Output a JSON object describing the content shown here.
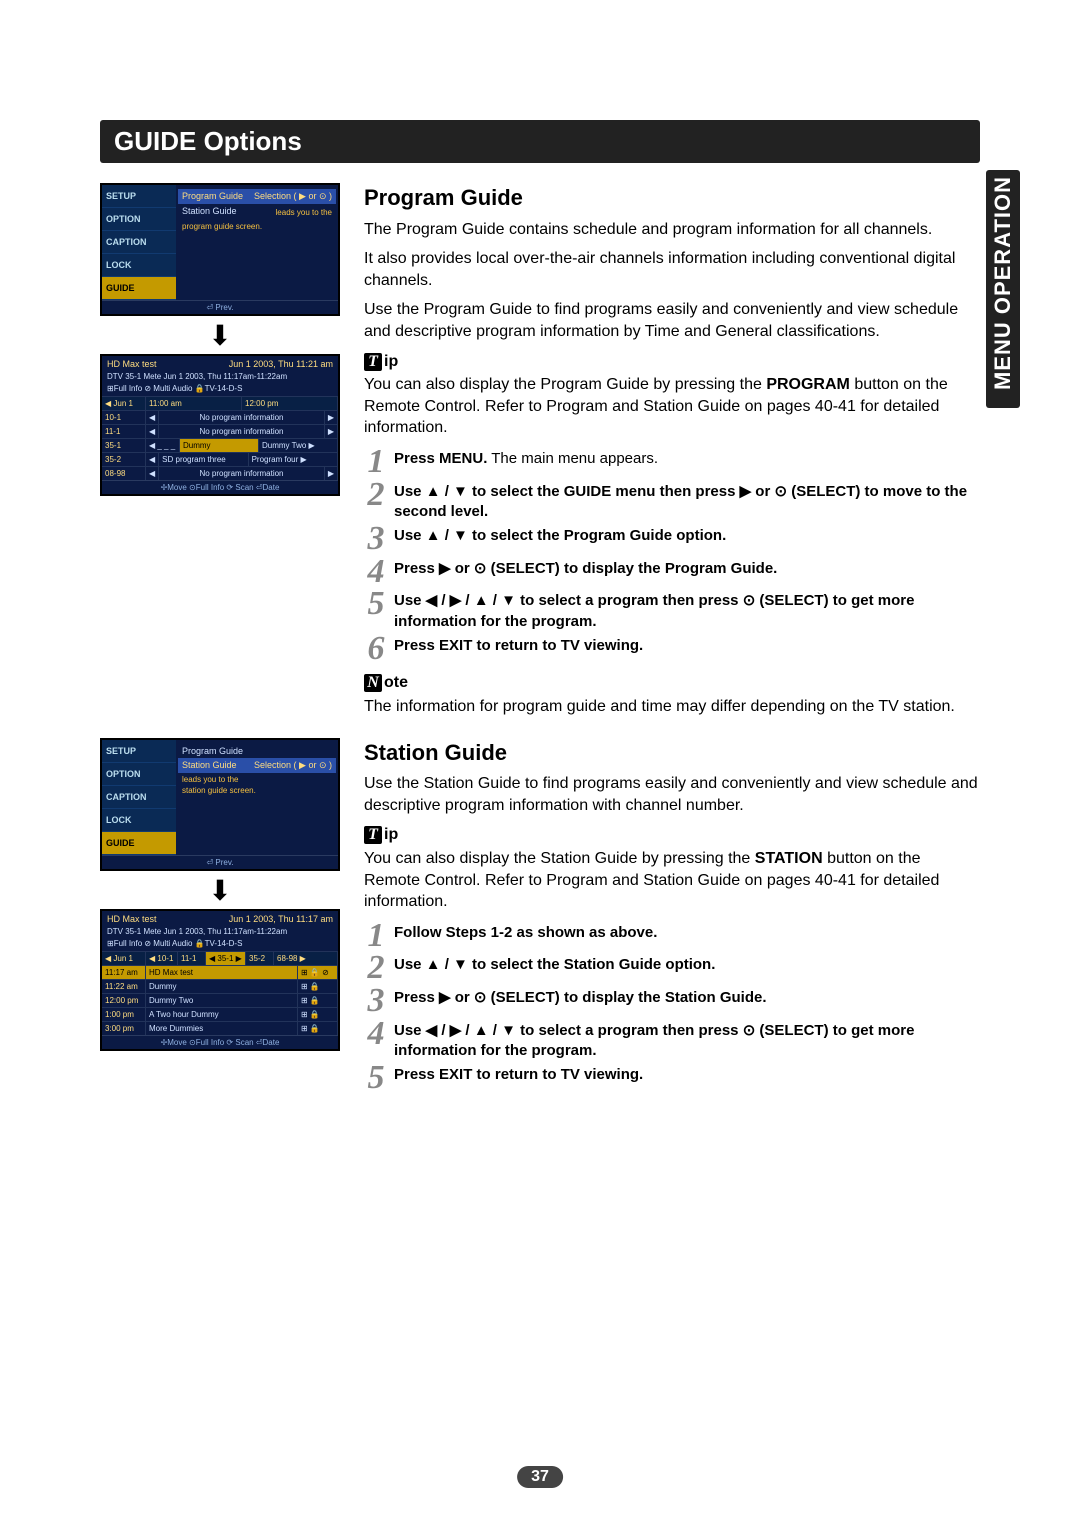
{
  "title_bar": "GUIDE Options",
  "side_tab": "MENU OPERATION",
  "page_number": "37",
  "program_guide": {
    "heading": "Program Guide",
    "intro1": "The Program Guide contains schedule and program information for all channels.",
    "intro2": "It also provides local over-the-air channels information including conventional digital channels.",
    "intro3": "Use the Program Guide to find programs easily and conveniently and view schedule and descriptive program information by Time and General classifications.",
    "tip_letter": "T",
    "tip_suffix": "ip",
    "tip_text_before": "You can also display the Program Guide by pressing the ",
    "tip_bold": "PROGRAM",
    "tip_text_after": " button on the Remote Control. Refer to Program and Station Guide on pages 40-41 for detailed information.",
    "steps": [
      {
        "n": "1",
        "bold": "Press MENU.",
        "rest": " The main menu appears."
      },
      {
        "n": "2",
        "bold": "Use ▲ / ▼ to select the GUIDE menu then press ▶ or ⊙ (SELECT) to move to the second level.",
        "rest": ""
      },
      {
        "n": "3",
        "bold": "Use ▲ / ▼ to select the Program Guide option.",
        "rest": ""
      },
      {
        "n": "4",
        "bold": "Press ▶ or ⊙ (SELECT) to display the Program Guide.",
        "rest": ""
      },
      {
        "n": "5",
        "bold": "Use ◀ / ▶ / ▲ / ▼ to select a program then press ⊙ (SELECT) to get more information for the program.",
        "rest": ""
      },
      {
        "n": "6",
        "bold": "Press EXIT to return to TV viewing.",
        "rest": ""
      }
    ],
    "note_letter": "N",
    "note_suffix": "ote",
    "note_text": "The information for program guide and time may differ depending on the TV station."
  },
  "station_guide": {
    "heading": "Station Guide",
    "intro": "Use the Station Guide to find programs easily and conveniently and view schedule and descriptive program information with channel number.",
    "tip_letter": "T",
    "tip_suffix": "ip",
    "tip_text_before": "You can also display the Station Guide by pressing the ",
    "tip_bold": "STATION",
    "tip_text_after": " button on the Remote Control. Refer to Program and Station Guide on pages 40-41 for detailed information.",
    "steps": [
      {
        "n": "1",
        "bold": "Follow Steps 1-2 as shown as above.",
        "rest": ""
      },
      {
        "n": "2",
        "bold": "Use ▲ / ▼ to select the Station Guide option.",
        "rest": ""
      },
      {
        "n": "3",
        "bold": "Press ▶ or ⊙ (SELECT) to display the Station Guide.",
        "rest": ""
      },
      {
        "n": "4",
        "bold": "Use ◀ / ▶ / ▲ / ▼ to select a program then press ⊙ (SELECT) to get more information for the program.",
        "rest": ""
      },
      {
        "n": "5",
        "bold": "Press EXIT to return to TV viewing.",
        "rest": ""
      }
    ]
  },
  "tv_menu": {
    "side_items": [
      "SETUP",
      "OPTION",
      "CAPTION",
      "LOCK",
      "GUIDE"
    ],
    "pg_item": "Program Guide",
    "sg_item": "Station Guide",
    "selection_hint": "Selection ( ▶ or ⊙ )",
    "hint1": "leads you to the",
    "hint2_pg": "program guide screen.",
    "hint2_sg": "station guide screen.",
    "foot": "⏎ Prev."
  },
  "pg_screen": {
    "title": "HD Max test",
    "date": "Jun 1 2003, Thu 11:21 am",
    "sub1": "DTV 35-1 Mete Jun 1 2003, Thu 11:17am-11:22am",
    "sub2": "⊞Full Info ⊘ Multi Audio 🔒TV-14-D-S",
    "date_nav": "◀ Jun 1",
    "time_cols": [
      "11:00 am",
      "12:00 pm"
    ],
    "rows": [
      {
        "ch": "10-1",
        "cells": [
          "◀",
          "No program information",
          "▶"
        ]
      },
      {
        "ch": "11-1",
        "cells": [
          "◀",
          "No program information",
          "▶"
        ]
      },
      {
        "ch": "35-1",
        "cells": [
          "◀ _ _ _",
          "Dummy",
          "Dummy Two ▶"
        ],
        "sel": 1
      },
      {
        "ch": "35-2",
        "cells": [
          "◀",
          "SD program three",
          "Program four ▶"
        ]
      },
      {
        "ch": "08-98",
        "cells": [
          "◀",
          "No program information",
          "▶"
        ]
      }
    ],
    "foot": "✢Move ⊙Full Info ⟳ Scan ⏎Date"
  },
  "sg_screen": {
    "title": "HD Max test",
    "date": "Jun 1 2003, Thu 11:17 am",
    "sub1": "DTV 35-1 Mete Jun 1 2003, Thu 11:17am-11:22am",
    "sub2": "⊞Full Info ⊘ Multi Audio 🔒TV-14-D-S",
    "date_nav": "◀ Jun 1",
    "ch_cols": [
      "◀ 10-1",
      "11-1",
      "◀ 35-1 ▶",
      "35-2",
      "68-98 ▶"
    ],
    "rows": [
      {
        "t": "11:17 am",
        "prog": "HD Max test",
        "sel": true,
        "icons": "⊞ 🔒 ⊘"
      },
      {
        "t": "11:22 am",
        "prog": "Dummy",
        "icons": "⊞ 🔒"
      },
      {
        "t": "12:00 pm",
        "prog": "Dummy Two",
        "icons": "⊞ 🔒"
      },
      {
        "t": "1:00 pm",
        "prog": "A Two hour Dummy",
        "icons": "⊞ 🔒"
      },
      {
        "t": "3:00 pm",
        "prog": "More Dummies",
        "icons": "⊞ 🔒"
      }
    ],
    "foot": "✢Move ⊙Full Info ⟳ Scan ⏎Date"
  }
}
